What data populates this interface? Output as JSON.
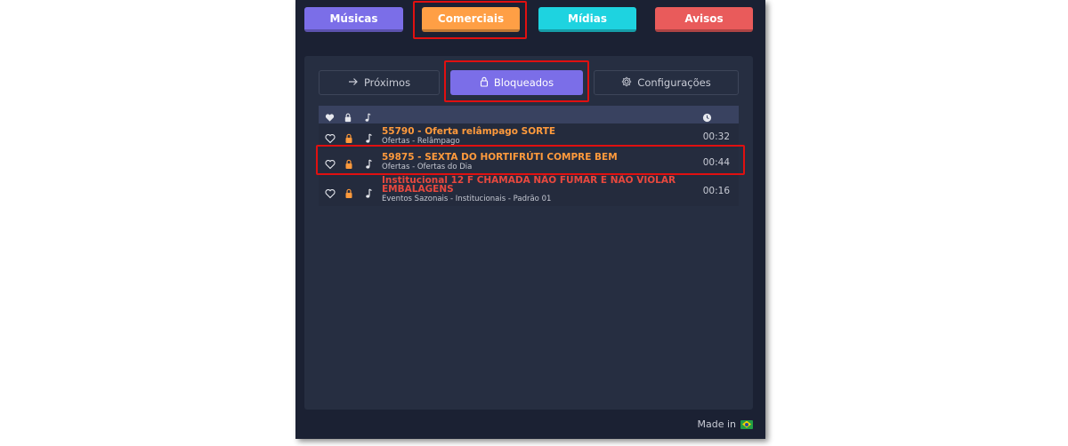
{
  "colors": {
    "musicas": "#7b6ee8",
    "comerciais": "#ff9f45",
    "midias": "#1ed3e0",
    "avisos": "#e95b5b",
    "bloqueados": "#7b6ee8",
    "title_orange": "#ff9a3c",
    "title_red": "#e8483e",
    "lock_orange": "#ff9a3c"
  },
  "categories": {
    "musicas": "Músicas",
    "comerciais": "Comerciais",
    "midias": "Mídias",
    "avisos": "Avisos"
  },
  "subtabs": {
    "proximos": "Próximos",
    "bloqueados": "Bloqueados",
    "configuracoes": "Configurações"
  },
  "rows": [
    {
      "title": "55790 - Oferta relâmpago SORTE",
      "subtitle": "Ofertas - Relâmpago",
      "duration": "00:32"
    },
    {
      "title": "59875 - SEXTA DO HORTIFRÚTI COMPRE BEM",
      "subtitle": "Ofertas - Ofertas do Dia",
      "duration": "00:44"
    },
    {
      "title": "Institucional 12 F CHAMADA NÃO FUMAR E NÃO VIOLAR EMBALAGENS",
      "subtitle": "Eventos Sazonais - Institucionais - Padrão 01",
      "duration": "00:16"
    }
  ],
  "footer": {
    "made_in": "Made in"
  }
}
